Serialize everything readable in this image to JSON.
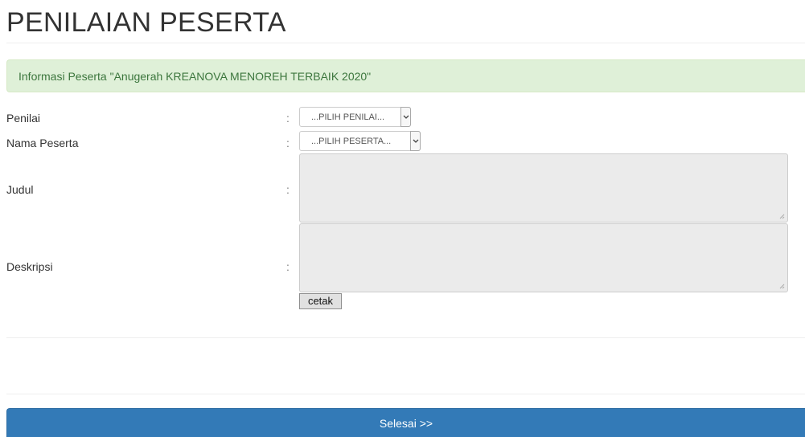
{
  "page": {
    "title": "PENILAIAN PESERTA"
  },
  "alert": {
    "text": "Informasi Peserta \"Anugerah KREANOVA MENOREH TERBAIK 2020\""
  },
  "form": {
    "separator": ":",
    "penilai": {
      "label": "Penilai",
      "selected": "...PILIH PENILAI..."
    },
    "peserta": {
      "label": "Nama Peserta",
      "selected": "...PILIH PESERTA..."
    },
    "judul": {
      "label": "Judul",
      "value": ""
    },
    "deskripsi": {
      "label": "Deskripsi",
      "value": ""
    },
    "print_label": "cetak"
  },
  "footer": {
    "submit_label": "Selesai >>"
  },
  "colors": {
    "alert_bg": "#dff0d8",
    "alert_text": "#3c763d",
    "primary": "#337ab7"
  },
  "icons": {
    "dropdown": "chevron-down-icon",
    "resize": "resize-grip-icon"
  }
}
